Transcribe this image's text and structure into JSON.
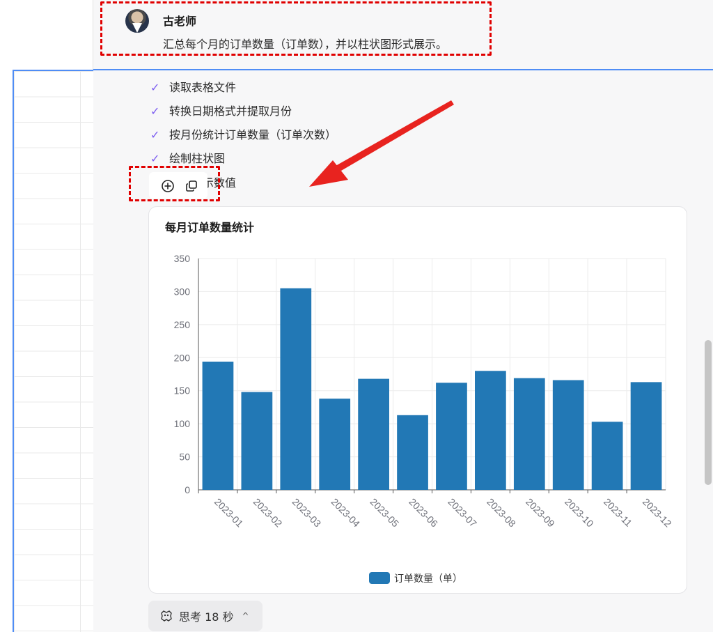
{
  "user": {
    "name": "古老师",
    "message": "汇总每个月的订单数量（订单数），并以柱状图形式展示。"
  },
  "steps": [
    {
      "label": "读取表格文件"
    },
    {
      "label": "转换日期格式并提取月份"
    },
    {
      "label": "按月份统计订单数量（订单次数）"
    },
    {
      "label": "绘制柱状图"
    },
    {
      "label": "上方显示数值"
    }
  ],
  "icons": {
    "check": "check-icon",
    "plus": "plus-circle-icon",
    "copy": "copy-icon",
    "think": "beta-think-icon"
  },
  "think": {
    "label": "思考 18 秒",
    "chevron": "^"
  },
  "colors": {
    "bar": "#2278b5",
    "check": "#7b5cf0",
    "highlight": "#e00000",
    "accent": "#4f8df5"
  },
  "chart_data": {
    "type": "bar",
    "title": "每月订单数量统计",
    "categories": [
      "2023-01",
      "2023-02",
      "2023-03",
      "2023-04",
      "2023-05",
      "2023-06",
      "2023-07",
      "2023-08",
      "2023-09",
      "2023-10",
      "2023-11",
      "2023-12"
    ],
    "series": [
      {
        "name": "订单数量（单）",
        "values": [
          194,
          148,
          305,
          138,
          168,
          113,
          162,
          180,
          169,
          166,
          103,
          163
        ]
      }
    ],
    "ylim": [
      0,
      350
    ],
    "yticks": [
      "0",
      "50",
      "100",
      "150",
      "200",
      "250",
      "300",
      "350"
    ],
    "grid": true,
    "legend": "bottom-center"
  }
}
